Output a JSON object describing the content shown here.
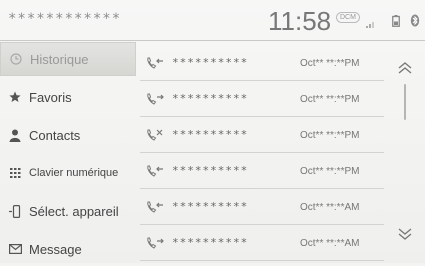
{
  "status": {
    "device_name": "************",
    "clock": "11:58",
    "dcm": "DCM",
    "icons": [
      "dcm-badge",
      "signal-icon",
      "battery-icon",
      "bluetooth-icon"
    ]
  },
  "sidebar": {
    "items": [
      {
        "label": "Historique",
        "icon": "clock-icon",
        "active": true
      },
      {
        "label": "Favoris",
        "icon": "star-icon",
        "active": false
      },
      {
        "label": "Contacts",
        "icon": "person-icon",
        "active": false
      },
      {
        "label": "Clavier numérique",
        "icon": "keypad-icon",
        "active": false
      },
      {
        "label": "Sélect. appareil",
        "icon": "phone-device-icon",
        "active": false
      },
      {
        "label": "Message",
        "icon": "envelope-icon",
        "active": false
      }
    ]
  },
  "call_history": {
    "rows": [
      {
        "type": "incoming",
        "number": "**********",
        "time": "Oct** **:**PM"
      },
      {
        "type": "outgoing",
        "number": "**********",
        "time": "Oct** **:**PM"
      },
      {
        "type": "missed",
        "number": "**********",
        "time": "Oct** **:**PM"
      },
      {
        "type": "incoming",
        "number": "**********",
        "time": "Oct** **:**PM"
      },
      {
        "type": "incoming",
        "number": "**********",
        "time": "Oct** **:**AM"
      },
      {
        "type": "outgoing",
        "number": "**********",
        "time": "Oct** **:**AM"
      }
    ]
  },
  "scroll": {
    "up_icon": "chevron-up-icon",
    "down_icon": "chevron-down-icon"
  },
  "colors": {
    "background": "#f3f3f1",
    "active_item": "#d9d9d6",
    "text": "#444444",
    "divider": "#d3d3cf"
  }
}
